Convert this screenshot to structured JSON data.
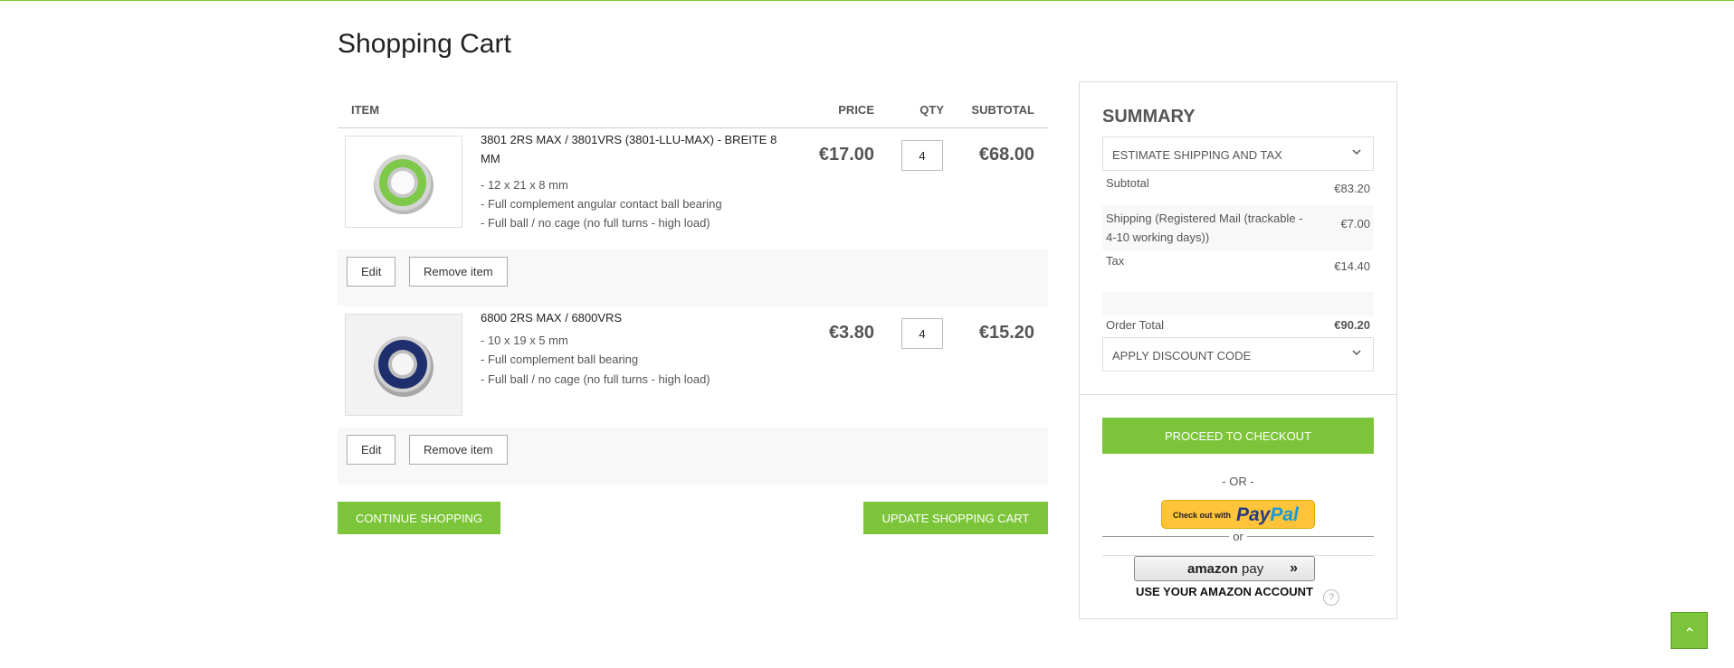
{
  "page": {
    "title": "Shopping Cart"
  },
  "table": {
    "headers": {
      "item": "ITEM",
      "price": "PRICE",
      "qty": "QTY",
      "subtotal": "SUBTOTAL"
    }
  },
  "items": [
    {
      "name": "3801 2RS MAX / 3801VRS (3801-LLU-MAX) - BREITE 8 MM",
      "options": [
        "- 12 x 21 x 8 mm",
        "- Full complement angular contact ball bearing",
        "- Full ball / no cage (no full turns - high load)"
      ],
      "price": "€17.00",
      "qty": "4",
      "subtotal": "€68.00",
      "edit_label": "Edit",
      "remove_label": "Remove item",
      "seal_color": "#7ec84a"
    },
    {
      "name": "6800 2RS MAX / 6800VRS",
      "options": [
        "- 10 x 19 x 5 mm",
        "- Full complement ball bearing",
        "- Full ball / no cage (no full turns - high load)"
      ],
      "price": "€3.80",
      "qty": "4",
      "subtotal": "€15.20",
      "edit_label": "Edit",
      "remove_label": "Remove item",
      "seal_color": "#1f2f6e"
    }
  ],
  "cart_actions": {
    "continue": "CONTINUE SHOPPING",
    "update": "UPDATE SHOPPING CART"
  },
  "summary": {
    "title": "SUMMARY",
    "estimate_label": "ESTIMATE SHIPPING AND TAX",
    "totals": [
      {
        "label": "Subtotal",
        "value": "€83.20"
      },
      {
        "label": "Shipping (Registered Mail (trackable - 4-10 working days))",
        "value": "€7.00"
      },
      {
        "label": "Tax",
        "value": "€14.40"
      },
      {
        "label": "Order Total",
        "value": "€90.20"
      }
    ],
    "discount_label": "APPLY DISCOUNT CODE",
    "checkout_label": "PROCEED TO CHECKOUT",
    "or_label": "- OR -",
    "paypal": {
      "prefix": "Check out with",
      "brand_a": "Pay",
      "brand_b": "Pal"
    },
    "or_small": "or",
    "amazon": {
      "brand_a": "amazon",
      "brand_b": " pay",
      "note": "USE YOUR AMAZON ACCOUNT",
      "help": "?"
    }
  },
  "colors": {
    "accent": "#7cc53a",
    "paypal_yellow": "#ffc439"
  },
  "icons": {
    "chevron": "chevron-down-icon",
    "scroll_top": "chevron-up-icon",
    "help": "help-icon"
  }
}
